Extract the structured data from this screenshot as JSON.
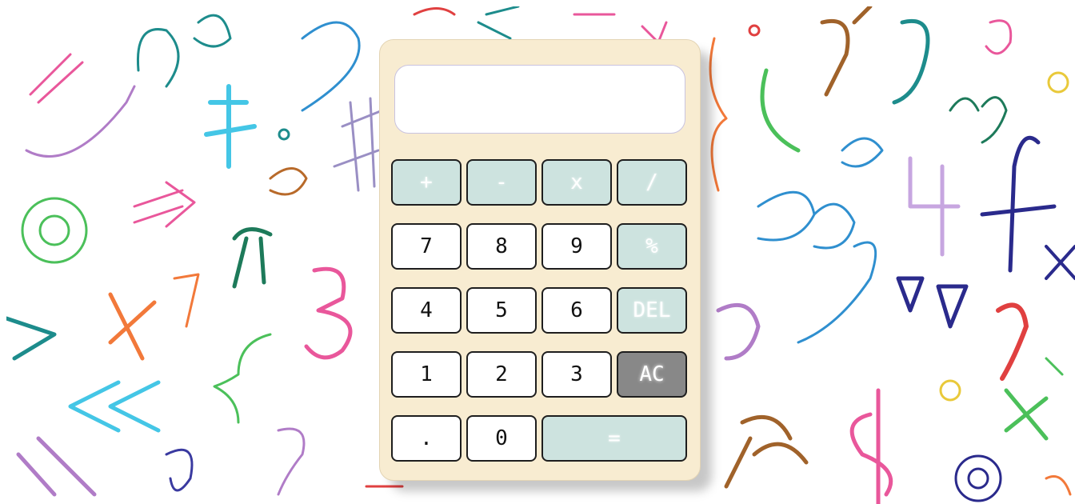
{
  "display": {
    "value": ""
  },
  "keys": {
    "plus": "+",
    "minus": "-",
    "multiply": "x",
    "divide": "/",
    "seven": "7",
    "eight": "8",
    "nine": "9",
    "percent": "%",
    "four": "4",
    "five": "5",
    "six": "6",
    "del": "DEL",
    "one": "1",
    "two": "2",
    "three": "3",
    "ac": "AC",
    "dot": ".",
    "zero": "0",
    "equals": "="
  },
  "background": {
    "symbols": [
      "ɔ",
      "ე",
      "e",
      "?",
      "#",
      "π",
      "@",
      "3",
      "!",
      "x",
      "«",
      "»",
      ">",
      "{",
      "}",
      "?",
      "e",
      "4",
      "f",
      "x",
      "9",
      "2",
      "$",
      "@",
      "log",
      "sin",
      "=",
      "ξ",
      "∇",
      "9",
      "9",
      "ℓ",
      "√",
      "5"
    ]
  },
  "colors": {
    "calculator_body": "#f8ecd1",
    "operator_key": "#cde3df",
    "ac_key": "#888888",
    "number_key": "#ffffff"
  }
}
